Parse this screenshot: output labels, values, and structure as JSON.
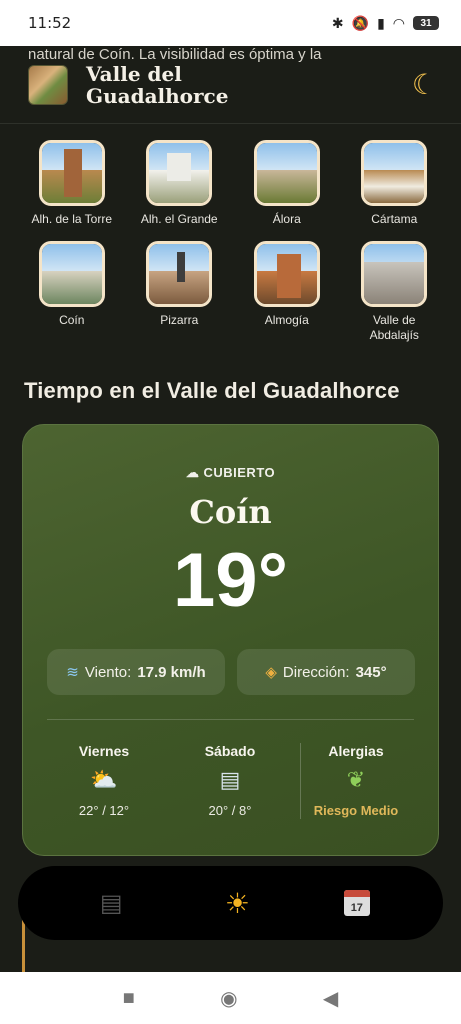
{
  "status": {
    "time": "11:52",
    "battery": "31"
  },
  "header": {
    "title_line1": "Valle del",
    "title_line2": "Guadalhorce"
  },
  "towns": [
    {
      "name": "Alh. de la Torre"
    },
    {
      "name": "Alh. el Grande"
    },
    {
      "name": "Álora"
    },
    {
      "name": "Cártama"
    },
    {
      "name": "Coín"
    },
    {
      "name": "Pizarra"
    },
    {
      "name": "Almogía"
    },
    {
      "name": "Valle de Abdalajís"
    }
  ],
  "weather": {
    "section_title": "Tiempo en el Valle del Guadalhorce",
    "condition": "CUBIERTO",
    "city": "Coín",
    "temperature": "19°",
    "wind_label": "Viento:",
    "wind_value": "17.9 km/h",
    "direction_label": "Dirección:",
    "direction_value": "345°",
    "forecast": [
      {
        "day": "Viernes",
        "range": "22° / 12°"
      },
      {
        "day": "Sábado",
        "range": "20° / 8°"
      }
    ],
    "allergy": {
      "label": "Alergias",
      "risk": "Riesgo Medio"
    }
  },
  "article": {
    "text": "natural de Coín. La visibilidad es óptima y la"
  },
  "nav": {
    "calendar_day": "17"
  },
  "icons": [
    "moon-icon",
    "cloud-icon",
    "wind-icon",
    "compass-icon",
    "sun-cloud-icon",
    "fog-icon",
    "leaf-icon",
    "newspaper-icon",
    "sun-icon",
    "calendar-icon"
  ]
}
